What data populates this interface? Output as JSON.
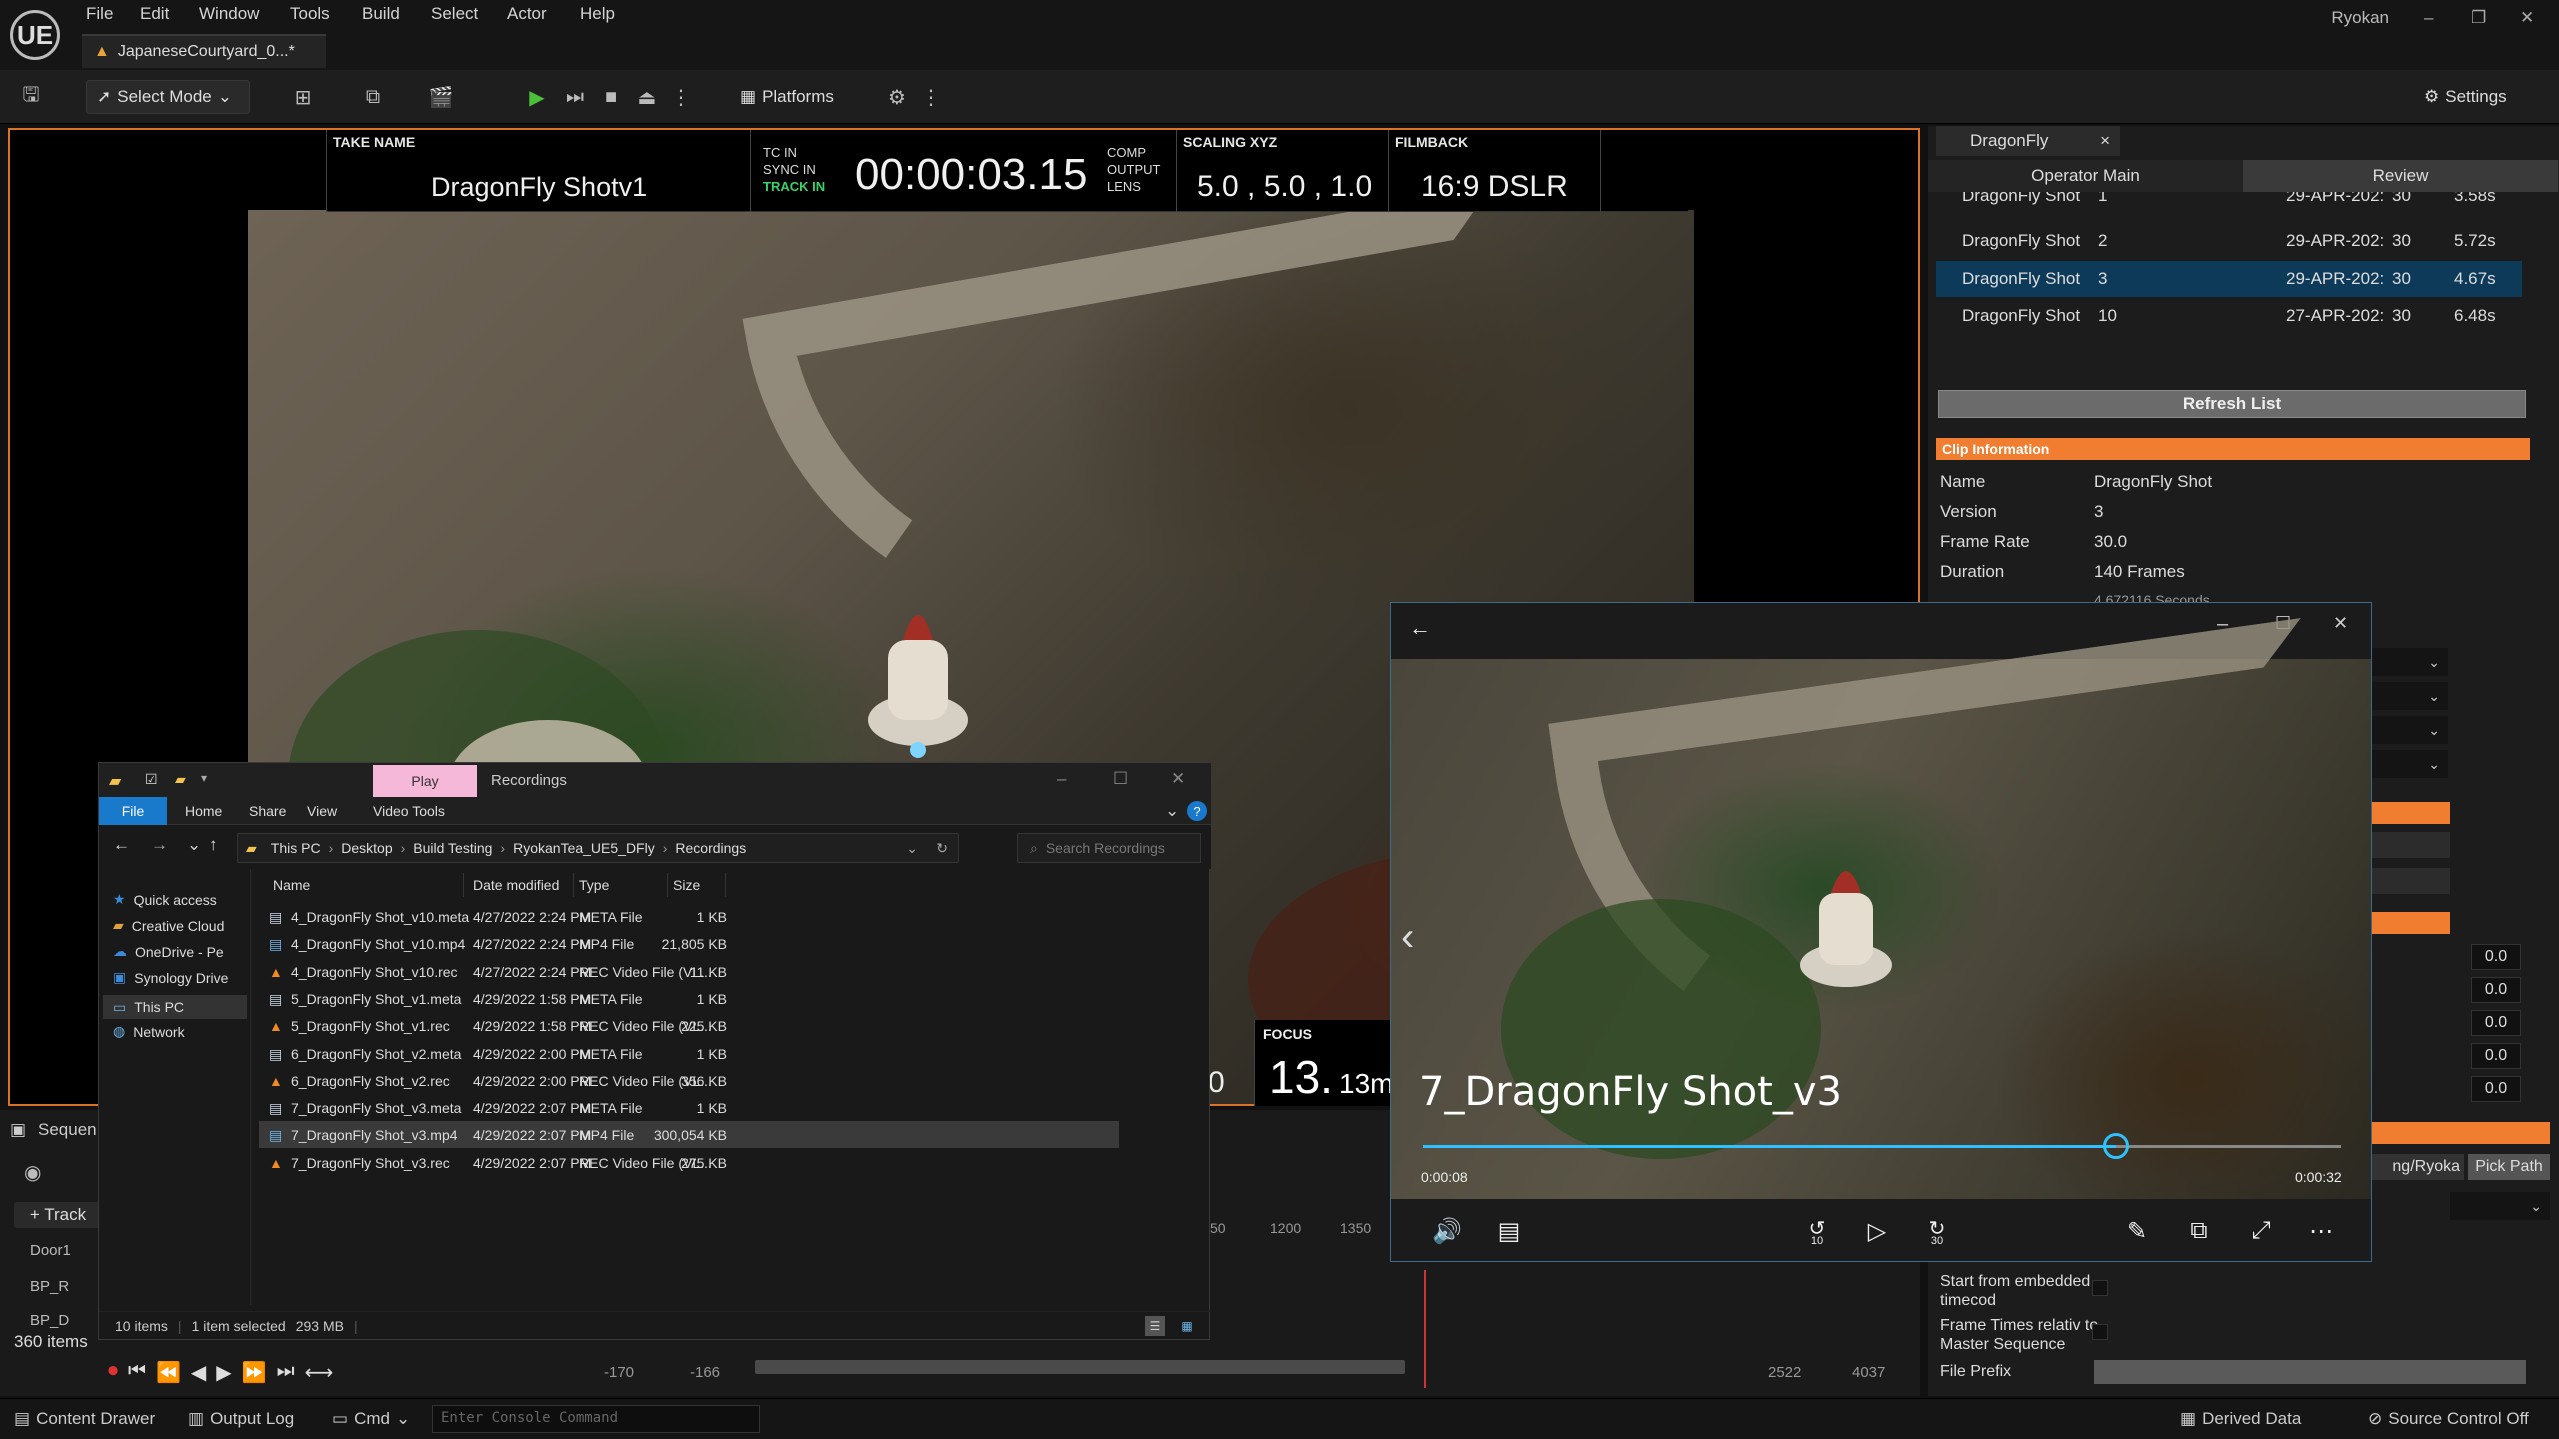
{
  "menubar": {
    "logo": "UE",
    "items": [
      "File",
      "Edit",
      "Window",
      "Tools",
      "Build",
      "Select",
      "Actor",
      "Help"
    ],
    "doc_tab": "JapaneseCourtyard_0...*",
    "project": "Ryokan",
    "window_controls": {
      "minimize": "–",
      "maximize": "❐",
      "close": "✕"
    }
  },
  "toolbar": {
    "select_mode": "Select Mode",
    "platforms": "Platforms",
    "settings": "Settings"
  },
  "hud": {
    "take_name_label": "TAKE NAME",
    "take_name": "DragonFly Shotv1",
    "tc_in": "TC IN",
    "sync_in": "SYNC IN",
    "track_in": "TRACK IN",
    "timecode": "00:00:03.15",
    "comp": "COMP",
    "output": "OUTPUT",
    "lens": "LENS",
    "scaling_label": "SCALING XYZ",
    "scaling": "5.0 , 5.0 , 1.0",
    "filmback_label": "FILMBACK",
    "filmback": "16:9 DSLR",
    "focus_label": "FOCUS",
    "focus_big": "13.",
    "focus_small": "13m",
    "partial_zero": "0"
  },
  "sequencer": {
    "title": "Sequen",
    "track_button": "+ Track",
    "rows": [
      "Door1",
      "BP_R",
      "BP_D"
    ],
    "items_count": "360 items",
    "ticks": [
      "50",
      "1200",
      "1350"
    ],
    "range_start": "-170",
    "range_start2": "-166",
    "range_end": "2522",
    "range_end2": "4037"
  },
  "statusbar": {
    "content_drawer": "Content Drawer",
    "output_log": "Output Log",
    "cmd": "Cmd",
    "console_placeholder": "Enter Console Command",
    "derived_data": "Derived Data",
    "source_control": "Source Control Off"
  },
  "right_panel": {
    "tab": "DragonFly",
    "tab_close": "×",
    "subtabs": [
      "Operator Main",
      "Review"
    ],
    "clips": [
      {
        "name": "DragonFly Shot",
        "ver": "1",
        "date": "29-APR-202:",
        "fps": "30",
        "dur": "3.58s"
      },
      {
        "name": "DragonFly Shot",
        "ver": "2",
        "date": "29-APR-202:",
        "fps": "30",
        "dur": "5.72s"
      },
      {
        "name": "DragonFly Shot",
        "ver": "3",
        "date": "29-APR-202:",
        "fps": "30",
        "dur": "4.67s"
      },
      {
        "name": "DragonFly Shot",
        "ver": "10",
        "date": "27-APR-202:",
        "fps": "30",
        "dur": "6.48s"
      }
    ],
    "refresh": "Refresh List",
    "clip_info_header": "Clip Information",
    "clip_info": [
      {
        "k": "Name",
        "v": "DragonFly Shot"
      },
      {
        "k": "Version",
        "v": "3"
      },
      {
        "k": "Frame Rate",
        "v": "30.0"
      },
      {
        "k": "Duration",
        "v": "140 Frames"
      }
    ],
    "duration_seconds": "4.672116 Seconds",
    "numbers": [
      "0.0",
      "0.0",
      "0.0",
      "0.0",
      "0.0"
    ],
    "path_btn": "ng/Ryoka",
    "pick_path": "Pick Path",
    "start_embedded": "Start from embedded timecod",
    "frame_times": "Frame Times relativ to Master Sequence",
    "file_prefix": "File Prefix"
  },
  "explorer": {
    "title": "Recordings",
    "play_tab": "Play",
    "ribbon": [
      "File",
      "Home",
      "Share",
      "View",
      "Video Tools"
    ],
    "path": [
      "This PC",
      "Desktop",
      "Build Testing",
      "RyokanTea_UE5_DFly",
      "Recordings"
    ],
    "search_placeholder": "Search Recordings",
    "nav": [
      "Quick access",
      "Creative Cloud",
      "OneDrive - Pe",
      "Synology Drive",
      "This PC",
      "Network"
    ],
    "columns": [
      "Name",
      "Date modified",
      "Type",
      "Size"
    ],
    "files": [
      {
        "name": "4_DragonFly Shot_v10.meta",
        "date": "4/27/2022 2:24 PM",
        "type": "META File",
        "size": "1 KB"
      },
      {
        "name": "4_DragonFly Shot_v10.mp4",
        "date": "4/27/2022 2:24 PM",
        "type": "MP4 File",
        "size": "21,805 KB"
      },
      {
        "name": "4_DragonFly Shot_v10.rec",
        "date": "4/27/2022 2:24 PM",
        "type": "REC Video File (VL...",
        "size": "11 KB"
      },
      {
        "name": "5_DragonFly Shot_v1.meta",
        "date": "4/29/2022 1:58 PM",
        "type": "META File",
        "size": "1 KB"
      },
      {
        "name": "5_DragonFly Shot_v1.rec",
        "date": "4/29/2022 1:58 PM",
        "type": "REC Video File (VL...",
        "size": "225 KB"
      },
      {
        "name": "6_DragonFly Shot_v2.meta",
        "date": "4/29/2022 2:00 PM",
        "type": "META File",
        "size": "1 KB"
      },
      {
        "name": "6_DragonFly Shot_v2.rec",
        "date": "4/29/2022 2:00 PM",
        "type": "REC Video File (VL...",
        "size": "356 KB"
      },
      {
        "name": "7_DragonFly Shot_v3.meta",
        "date": "4/29/2022 2:07 PM",
        "type": "META File",
        "size": "1 KB"
      },
      {
        "name": "7_DragonFly Shot_v3.mp4",
        "date": "4/29/2022 2:07 PM",
        "type": "MP4 File",
        "size": "300,054 KB"
      },
      {
        "name": "7_DragonFly Shot_v3.rec",
        "date": "4/29/2022 2:07 PM",
        "type": "REC Video File (VL...",
        "size": "275 KB"
      }
    ],
    "status_items": "10 items",
    "status_selected": "1 item selected",
    "status_size": "293 MB"
  },
  "player": {
    "title": "7_DragonFly Shot_v3",
    "elapsed": "0:00:08",
    "total": "0:00:32",
    "progress": 0.755,
    "skip_back": "10",
    "skip_fwd": "30"
  },
  "colors": {
    "accent_orange": "#f07d30",
    "selected_row": "#0e3a5a",
    "player_accent": "#2fc1ff",
    "explorer_file_tab": "#1979ca",
    "play_tab": "#f6b8d8"
  }
}
